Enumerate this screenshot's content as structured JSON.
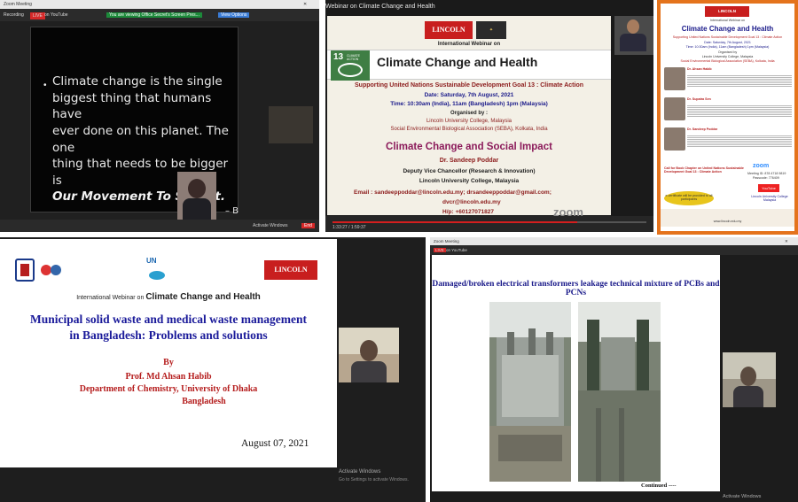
{
  "panel1": {
    "window_title": "Zoom Meeting",
    "recording_label": "Recording",
    "live_badge": "LIVE",
    "youtube_label": "on YouTube",
    "speaking_label": "You are viewing Office Secret's Screen Pres...",
    "view_options": "View Options",
    "bullet": "•",
    "quote_line1": "Climate change is the single",
    "quote_line2": "biggest thing that humans have",
    "quote_line3": "ever done on this planet. The one",
    "quote_line4": "thing that needs to be bigger is",
    "quote_emph": "Our Movement To Stop It.",
    "quote_attrib": "– B",
    "activate_windows": "Activate Windows"
  },
  "panel2": {
    "tab_title": "Webinar on Climate Change and Health",
    "lincoln_logo": "LINCOLN",
    "lincoln_sub": "UNIVERSITY COLLEGE",
    "intl": "International Webinar on",
    "sdg_num": "13",
    "sdg_label": "CLIMATE ACTION",
    "main_title": "Climate Change and Health",
    "subtitle": "Supporting United Nations Sustainable Development Goal 13 : Climate Action",
    "date": "Date: Saturday, 7th August, 2021",
    "time": "Time: 10:30am (India), 11am (Bangladesh) 1pm (Malaysia)",
    "organised": "Organised by :",
    "org1": "Lincoln University College, Malaysia",
    "org2": "Social Environmental Biological Association (SEBA), Kolkata, India",
    "talk_title": "Climate Change and Social Impact",
    "speaker": "Dr. Sandeep Poddar",
    "role": "Deputy Vice Chancellor (Research & Innovation)",
    "institution": "Lincoln University College, Malaysia",
    "email": "Email : sandeeppoddar@lincoln.edu.my; drsandeeppoddar@gmail.com;",
    "email2": "dvcr@lincoln.edu.my",
    "hp": "H/p: +60127071827",
    "zoom_watermark": "zoom",
    "timecode": "1:33:27 / 1:59:37",
    "progress": 0.78
  },
  "panel3": {
    "logo": "LINCOLN",
    "intl": "International Webinar on",
    "title": "Climate Change and Health",
    "subtitle": "Supporting United Nations Sustainable Development Goal 13 : Climate Action",
    "date": "Date: Saturday, 7th August, 2021",
    "time": "Time: 10:30am (India), 11am (Bangladesh) 1pm (Malaysia)",
    "organised": "Organised by",
    "org1": "Lincoln University College, Malaysia",
    "org2": "Social Environmental Biological Association (SEBA), Kolkata, India",
    "speaker1": "Dr. Ahsan Habib",
    "speaker2": "Dr. Supatra Sen",
    "speaker3": "Dr. Sandeep Poddar",
    "call": "Call for Book Chapter on United Nations Sustainable Development Goal 13 : Climate Action",
    "zoom": "zoom",
    "meeting": "Meeting ID: 878 4718 9819",
    "passcode": "Passcode: 776409",
    "youtube": "YouTube",
    "certificate": "e-certificate will be provided to all participants",
    "footer": "Lincoln University College Malaysia",
    "website": "www.lincoln.edu.my"
  },
  "panel4": {
    "un_logo": "UN",
    "lincoln_logo": "LINCOLN",
    "webinar_prefix": "International Webinar on",
    "webinar_title": "Climate Change and Health",
    "title1": "Municipal solid waste and medical waste management",
    "title2": "in Bangladesh: Problems and solutions",
    "by": "By",
    "author": "Prof. Md Ahsan Habib",
    "dept": "Department of Chemistry, University of Dhaka",
    "country": "Bangladesh",
    "date": "August 07, 2021",
    "activate_windows": "Activate Windows",
    "activate_sub": "Go to Settings to activate Windows."
  },
  "panel5": {
    "window_title": "Zoom Meeting",
    "live_badge": "LIVE",
    "youtube_label": "on YouTube",
    "title": "Damaged/broken electrical transformers leakage technical mixture of PCBs and PCNs",
    "continued": "Continued ----",
    "activate_windows": "Activate Windows"
  }
}
